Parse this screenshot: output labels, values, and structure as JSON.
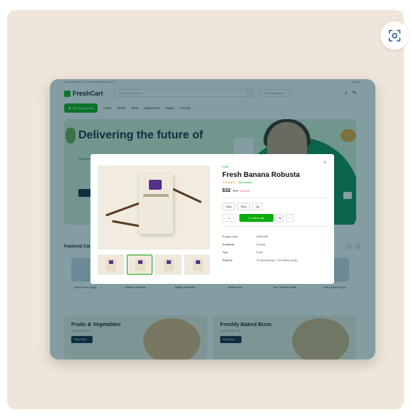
{
  "outer": {
    "scan_icon": "scan-focus-icon"
  },
  "site": {
    "topbar_left": "Super Value Deals - Save more with coupons",
    "topbar_right": "English",
    "logo": "FreshCart",
    "search_placeholder": "Search for products",
    "location": "Find a location",
    "nav": {
      "departments": "All Departments",
      "links": [
        "Home",
        "Stores",
        "Shop",
        "Mega menu",
        "Pages",
        "Account"
      ]
    },
    "hero": {
      "title": "Delivering the future of",
      "subtitle": "Introducing the new shopping experience"
    },
    "featured_title": "Featured Categories",
    "categories": [
      {
        "label": "Dairy, Bread & Eggs",
        "color": "#cfd9e4"
      },
      {
        "label": "Snack & Munchies",
        "color": "#e9d7c2"
      },
      {
        "label": "Bakery & Biscuits",
        "color": "#efd6b3"
      },
      {
        "label": "Instant Food",
        "color": "#e6c9a4"
      },
      {
        "label": "Tea, Coffee & Drinks",
        "color": "#c9d7c3"
      },
      {
        "label": "Dairy, Bread & Eggs",
        "color": "#cfd9e4"
      }
    ],
    "promos": [
      {
        "title": "Fruits & Vegetables",
        "sub": "Get Upto 30% Off",
        "button": "Shop Now",
        "color": "#e7b37c"
      },
      {
        "title": "Freshly Baked Buns",
        "sub": "Get Upto 25% Off",
        "button": "Shop Now",
        "color": "#d7b384"
      }
    ]
  },
  "modal": {
    "close_icon": "close-icon",
    "bag_text": "HANDCRAFTED",
    "category": "Fruits",
    "title": "Fresh Banana Robusta",
    "stars": "★★★★★",
    "reviews": "(30 reviews)",
    "price": "$32",
    "old_price": "$35",
    "discount": "26% Off",
    "sizes": [
      "250g",
      "500g",
      "1kg"
    ],
    "qty": {
      "minus": "-",
      "value": "1",
      "plus": "+"
    },
    "add_to_cart": "Add to cart",
    "details": [
      {
        "key": "Product Code:",
        "value": "FBB00255"
      },
      {
        "key": "Availability:",
        "value": "In Stock"
      },
      {
        "key": "Type:",
        "value": "Fruits"
      },
      {
        "key": "Shipping:",
        "value": "01 day shipping. ( Free pickup today)"
      }
    ]
  },
  "colors": {
    "accent": "#0aad0a",
    "navy": "#15223a",
    "backdrop": "#efe5da"
  }
}
